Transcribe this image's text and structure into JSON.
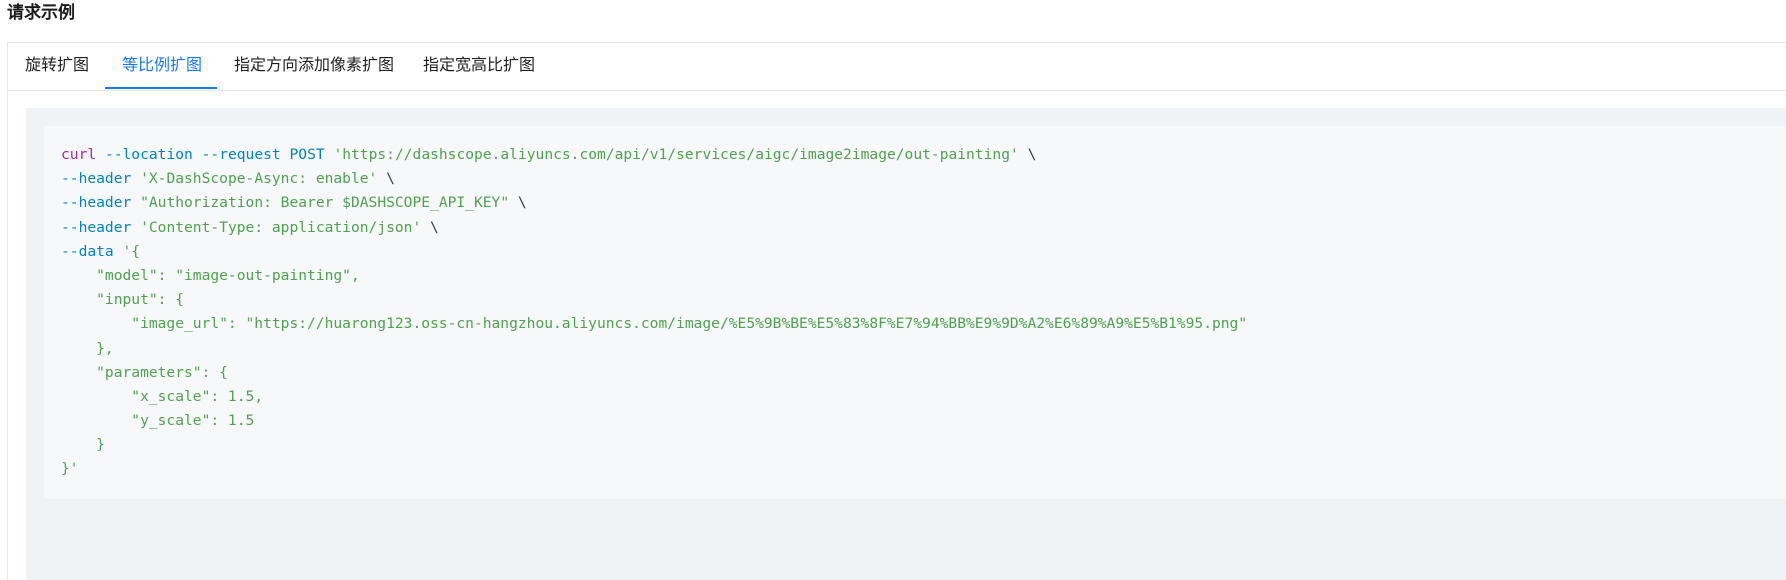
{
  "section": {
    "title": "请求示例"
  },
  "tabs": [
    {
      "label": "旋转扩图",
      "active": false
    },
    {
      "label": "等比例扩图",
      "active": true
    },
    {
      "label": "指定方向添加像素扩图",
      "active": false
    },
    {
      "label": "指定宽高比扩图",
      "active": false
    }
  ],
  "colors": {
    "accent": "#1677ff",
    "code_command": "#a626a4",
    "code_flag": "#0184bc",
    "code_string": "#50a14f",
    "code_background": "#f6f8fa"
  },
  "code": {
    "lines": [
      [
        {
          "t": "cmd",
          "v": "curl"
        },
        {
          "t": "plain",
          "v": " "
        },
        {
          "t": "flag",
          "v": "--location"
        },
        {
          "t": "plain",
          "v": " "
        },
        {
          "t": "flag",
          "v": "--request"
        },
        {
          "t": "plain",
          "v": " "
        },
        {
          "t": "flag",
          "v": "POST"
        },
        {
          "t": "plain",
          "v": " "
        },
        {
          "t": "str",
          "v": "'https://dashscope.aliyuncs.com/api/v1/services/aigc/image2image/out-painting'"
        },
        {
          "t": "plain",
          "v": " \\"
        }
      ],
      [
        {
          "t": "flag",
          "v": "--header"
        },
        {
          "t": "plain",
          "v": " "
        },
        {
          "t": "str",
          "v": "'X-DashScope-Async: enable'"
        },
        {
          "t": "plain",
          "v": " \\"
        }
      ],
      [
        {
          "t": "flag",
          "v": "--header"
        },
        {
          "t": "plain",
          "v": " "
        },
        {
          "t": "str",
          "v": "\"Authorization: Bearer $DASHSCOPE_API_KEY\""
        },
        {
          "t": "plain",
          "v": " \\"
        }
      ],
      [
        {
          "t": "flag",
          "v": "--header"
        },
        {
          "t": "plain",
          "v": " "
        },
        {
          "t": "str",
          "v": "'Content-Type: application/json'"
        },
        {
          "t": "plain",
          "v": " \\"
        }
      ],
      [
        {
          "t": "flag",
          "v": "--data"
        },
        {
          "t": "plain",
          "v": " "
        },
        {
          "t": "str",
          "v": "'{"
        }
      ],
      [
        {
          "t": "str",
          "v": "    \"model\": \"image-out-painting\","
        }
      ],
      [
        {
          "t": "str",
          "v": "    \"input\": {"
        }
      ],
      [
        {
          "t": "str",
          "v": "        \"image_url\": \"https://huarong123.oss-cn-hangzhou.aliyuncs.com/image/%E5%9B%BE%E5%83%8F%E7%94%BB%E9%9D%A2%E6%89%A9%E5%B1%95.png\""
        }
      ],
      [
        {
          "t": "str",
          "v": "    },"
        }
      ],
      [
        {
          "t": "str",
          "v": "    \"parameters\": {"
        }
      ],
      [
        {
          "t": "str",
          "v": "        \"x_scale\": 1.5,"
        }
      ],
      [
        {
          "t": "str",
          "v": "        \"y_scale\": 1.5"
        }
      ],
      [
        {
          "t": "str",
          "v": "    }"
        }
      ],
      [
        {
          "t": "str",
          "v": "}'"
        }
      ]
    ]
  }
}
